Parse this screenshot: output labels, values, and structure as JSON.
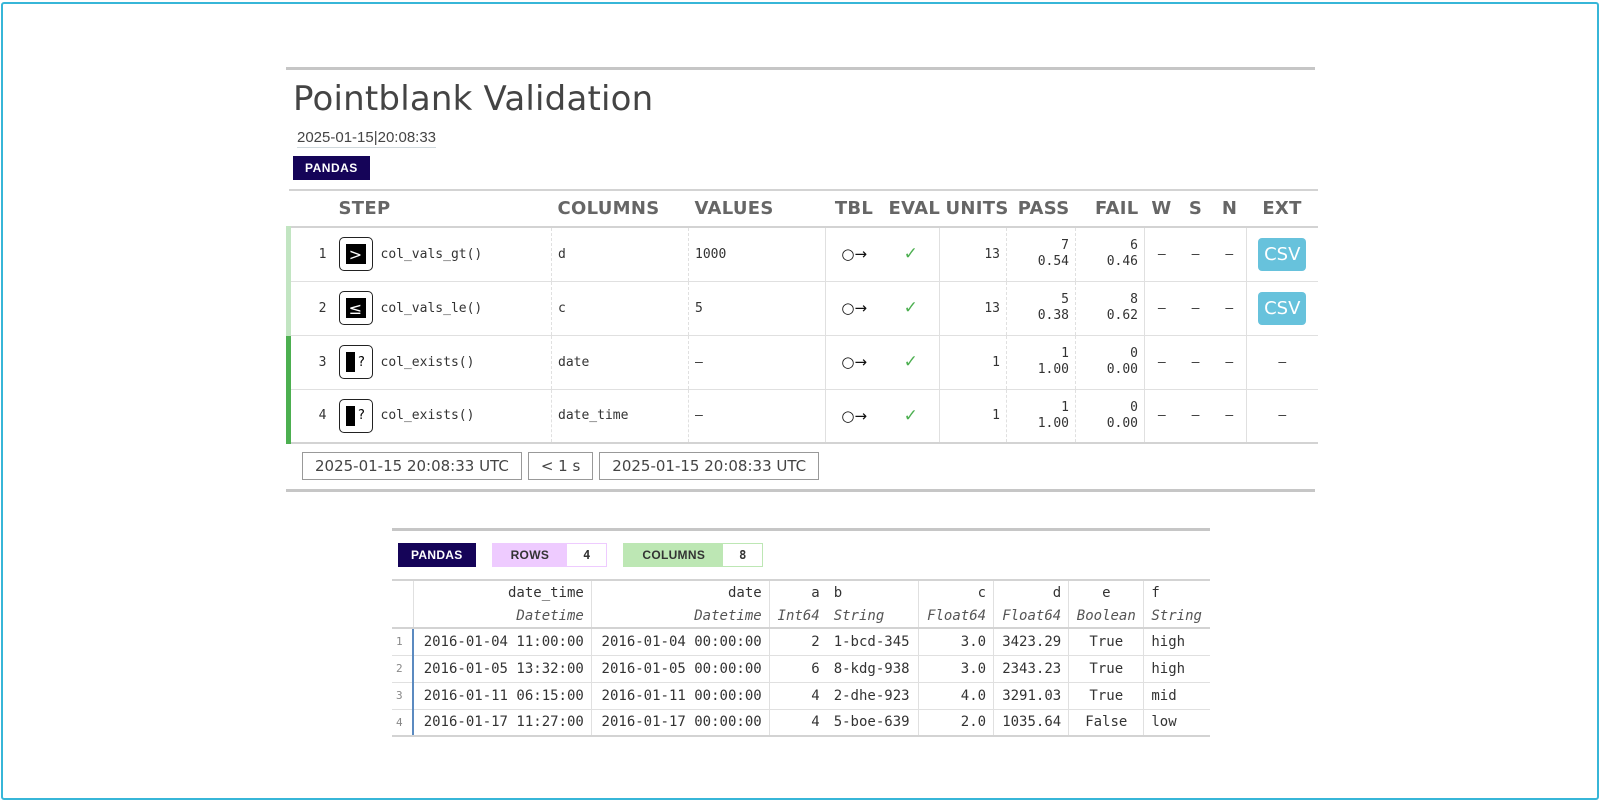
{
  "report": {
    "title": "Pointblank Validation",
    "subtitle": "2025-01-15|20:08:33",
    "table_type": "PANDAS",
    "headers": {
      "step": "STEP",
      "columns": "COLUMNS",
      "values": "VALUES",
      "tbl": "TBL",
      "eval": "EVAL",
      "units": "UNITS",
      "pass": "PASS",
      "fail": "FAIL",
      "w": "W",
      "s": "S",
      "n": "N",
      "ext": "EXT"
    },
    "steps": [
      {
        "num": "1",
        "icon": "greater-than-icon",
        "icon_glyph": ">",
        "name": "col_vals_gt()",
        "column": "d",
        "value": "1000",
        "tbl": "○→",
        "eval": "✓",
        "units": "13",
        "pass_n": "7",
        "pass_f": "0.54",
        "fail_n": "6",
        "fail_f": "0.46",
        "w": "—",
        "s": "—",
        "n": "—",
        "ext": "CSV"
      },
      {
        "num": "2",
        "icon": "less-equal-icon",
        "icon_glyph": "≤",
        "name": "col_vals_le()",
        "column": "c",
        "value": "5",
        "tbl": "○→",
        "eval": "✓",
        "units": "13",
        "pass_n": "5",
        "pass_f": "0.38",
        "fail_n": "8",
        "fail_f": "0.62",
        "w": "—",
        "s": "—",
        "n": "—",
        "ext": "CSV"
      },
      {
        "num": "3",
        "icon": "column-exists-icon",
        "icon_glyph": "?",
        "name": "col_exists()",
        "column": "date",
        "value": "—",
        "tbl": "○→",
        "eval": "✓",
        "units": "1",
        "pass_n": "1",
        "pass_f": "1.00",
        "fail_n": "0",
        "fail_f": "0.00",
        "w": "—",
        "s": "—",
        "n": "—",
        "ext": "—"
      },
      {
        "num": "4",
        "icon": "column-exists-icon",
        "icon_glyph": "?",
        "name": "col_exists()",
        "column": "date_time",
        "value": "—",
        "tbl": "○→",
        "eval": "✓",
        "units": "1",
        "pass_n": "1",
        "pass_f": "1.00",
        "fail_n": "0",
        "fail_f": "0.00",
        "w": "—",
        "s": "—",
        "n": "—",
        "ext": "—"
      }
    ],
    "footer": {
      "start_time": "2025-01-15 20:08:33 UTC",
      "duration": "< 1 s",
      "end_time": "2025-01-15 20:08:33 UTC"
    }
  },
  "preview": {
    "table_type": "PANDAS",
    "rows_label": "ROWS",
    "rows_value": "4",
    "columns_label": "COLUMNS",
    "columns_value": "8",
    "columns": [
      {
        "name": "date_time",
        "type": "Datetime",
        "align": "right"
      },
      {
        "name": "date",
        "type": "Datetime",
        "align": "right"
      },
      {
        "name": "a",
        "type": "Int64",
        "align": "right"
      },
      {
        "name": "b",
        "type": "String",
        "align": "left"
      },
      {
        "name": "c",
        "type": "Float64",
        "align": "right"
      },
      {
        "name": "d",
        "type": "Float64",
        "align": "right"
      },
      {
        "name": "e",
        "type": "Boolean",
        "align": "center"
      },
      {
        "name": "f",
        "type": "String",
        "align": "left"
      }
    ],
    "rows": [
      {
        "num": "1",
        "cells": [
          "2016-01-04 11:00:00",
          "2016-01-04 00:00:00",
          "2",
          "1-bcd-345",
          "3.0",
          "3423.29",
          "True",
          "high"
        ]
      },
      {
        "num": "2",
        "cells": [
          "2016-01-05 13:32:00",
          "2016-01-05 00:00:00",
          "6",
          "8-kdg-938",
          "3.0",
          "2343.23",
          "True",
          "high"
        ]
      },
      {
        "num": "3",
        "cells": [
          "2016-01-11 06:15:00",
          "2016-01-11 00:00:00",
          "4",
          "2-dhe-923",
          "4.0",
          "3291.03",
          "True",
          "mid"
        ]
      },
      {
        "num": "4",
        "cells": [
          "2016-01-17 11:27:00",
          "2016-01-17 00:00:00",
          "4",
          "5-boe-639",
          "2.0",
          "1035.64",
          "False",
          "low"
        ]
      }
    ]
  },
  "colors": {
    "frame_border": "#37b6d8",
    "pandas_badge": "#150458",
    "csv_button": "#67c2dc",
    "pass_check": "#4caf50",
    "rows_badge": "#eecbff",
    "columns_badge": "#bde7b4"
  }
}
